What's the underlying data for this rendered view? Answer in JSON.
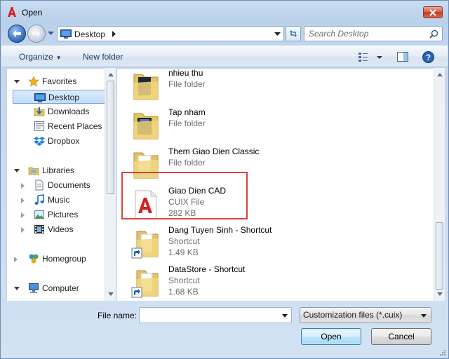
{
  "window": {
    "title": "Open"
  },
  "nav": {
    "address": "Desktop",
    "search_placeholder": "Search Desktop"
  },
  "toolbar": {
    "organize_label": "Organize",
    "new_folder_label": "New folder"
  },
  "sidebar": {
    "items": [
      {
        "label": "Favorites",
        "icon": "star-icon"
      },
      {
        "label": "Desktop",
        "icon": "desktop-icon",
        "selected": true
      },
      {
        "label": "Downloads",
        "icon": "downloads-icon"
      },
      {
        "label": "Recent Places",
        "icon": "recent-places-icon"
      },
      {
        "label": "Dropbox",
        "icon": "dropbox-icon"
      },
      {
        "label": "Libraries",
        "icon": "libraries-icon"
      },
      {
        "label": "Documents",
        "icon": "documents-icon"
      },
      {
        "label": "Music",
        "icon": "music-icon"
      },
      {
        "label": "Pictures",
        "icon": "pictures-icon"
      },
      {
        "label": "Videos",
        "icon": "videos-icon"
      },
      {
        "label": "Homegroup",
        "icon": "homegroup-icon"
      },
      {
        "label": "Computer",
        "icon": "computer-icon"
      }
    ]
  },
  "files": [
    {
      "name": "nhieu thu",
      "type": "File folder",
      "size": "",
      "icon": "folder-icon"
    },
    {
      "name": "Tap nham",
      "type": "File folder",
      "size": "",
      "icon": "folder-icon"
    },
    {
      "name": "Them Giao Dien Classic",
      "type": "File folder",
      "size": "",
      "icon": "folder-icon"
    },
    {
      "name": "Giao Dien CAD",
      "type": "CUIX File",
      "size": "282 KB",
      "icon": "autocad-file-icon",
      "highlighted": true
    },
    {
      "name": "Dang Tuyen Sinh - Shortcut",
      "type": "Shortcut",
      "size": "1.49 KB",
      "icon": "shortcut-folder-icon"
    },
    {
      "name": "DataStore - Shortcut",
      "type": "Shortcut",
      "size": "1.68 KB",
      "icon": "shortcut-folder-icon"
    }
  ],
  "bottom": {
    "filename_label": "File name:",
    "filename_value": "",
    "filetype_value": "Customization files (*.cuix)",
    "open_label": "Open",
    "cancel_label": "Cancel"
  },
  "colors": {
    "highlight_border": "#d9453a",
    "selection_fill": "#c1dcfb",
    "accent_blue": "#3a74c4"
  }
}
